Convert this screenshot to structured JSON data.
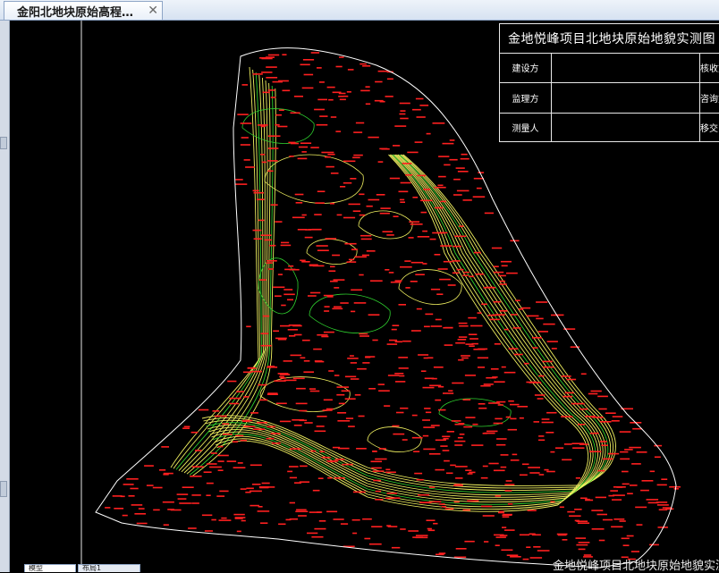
{
  "tab": {
    "title": "金阳北地块原始高程…",
    "close_icon": "close-icon"
  },
  "title_block": {
    "title": "金地悦峰项目北地块原始地貌实测图",
    "rows": [
      {
        "label": "建设方",
        "label2": "核收方"
      },
      {
        "label": "监理方",
        "label2": "咨询方"
      },
      {
        "label": "测量人",
        "label2": "移交日"
      }
    ]
  },
  "bottom_caption": "金地悦峰项目北地块原始地貌实测图",
  "bottom_tabs": [
    "模型",
    "布局1"
  ],
  "colors": {
    "background": "#000000",
    "contour_yellow": "#f0f060",
    "contour_green": "#2fd12f",
    "elevation_points": "#ff2020",
    "boundary": "#ffffff"
  }
}
